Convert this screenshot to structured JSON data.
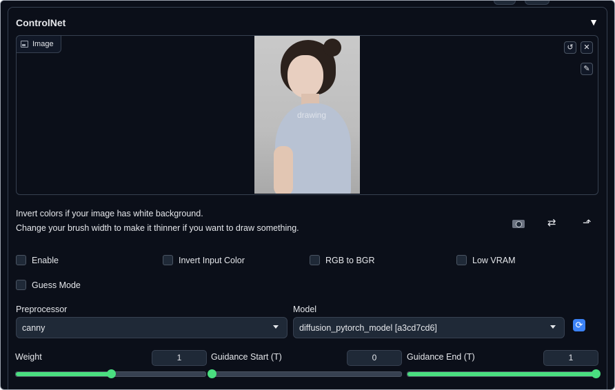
{
  "panel": {
    "title": "ControlNet",
    "collapse_icon": "triangle-down"
  },
  "image": {
    "label": "Image",
    "watermark": "drawing",
    "tools": {
      "reset_icon": "undo",
      "clear_icon": "close",
      "brush_icon": "brush"
    }
  },
  "hints": {
    "line1": "Invert colors if your image has white background.",
    "line2": "Change your brush width to make it thinner if you want to draw something."
  },
  "actions": {
    "camera_icon": "camera-icon",
    "swap_icon": "⇄",
    "upload_icon": "⬏"
  },
  "checkboxes": {
    "enable": "Enable",
    "invert": "Invert Input Color",
    "rgb_bgr": "RGB to BGR",
    "low_vram": "Low VRAM",
    "guess": "Guess Mode"
  },
  "preprocessor": {
    "label": "Preprocessor",
    "value": "canny"
  },
  "model": {
    "label": "Model",
    "value": "diffusion_pytorch_model [a3cd7cd6]"
  },
  "sliders": {
    "weight": {
      "label": "Weight",
      "value": "1",
      "fraction": 0.5
    },
    "guidance_start": {
      "label": "Guidance Start (T)",
      "value": "0",
      "fraction": 0.0
    },
    "guidance_end": {
      "label": "Guidance End (T)",
      "value": "1",
      "fraction": 1.0
    }
  },
  "colors": {
    "accent": "#4ade80",
    "background": "#0b0f19",
    "refresh": "#3b82f6"
  }
}
